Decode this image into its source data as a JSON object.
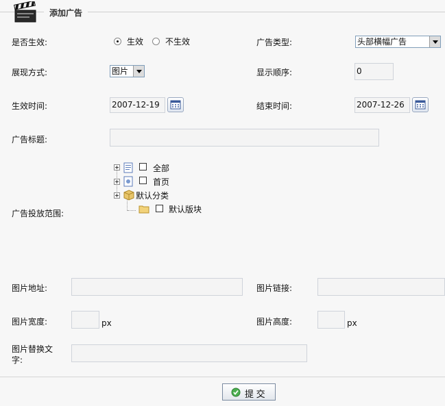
{
  "header": {
    "title": "添加广告",
    "icon": "clapperboard-icon"
  },
  "form": {
    "active_label": "是否生效:",
    "active_options": [
      "生效",
      "不生效"
    ],
    "active_selected": "生效",
    "ad_type_label": "广告类型:",
    "ad_type_value": "头部横幅广告",
    "display_mode_label": "展现方式:",
    "display_mode_value": "图片",
    "display_order_label": "显示顺序:",
    "display_order_value": "0",
    "start_time_label": "生效时间:",
    "start_time_value": "2007-12-19",
    "end_time_label": "结束时间:",
    "end_time_value": "2007-12-26",
    "ad_title_label": "广告标题:",
    "ad_title_value": "",
    "scope_label": "广告投放范围:",
    "scope_tree": {
      "all": "全部",
      "home": "首页",
      "default_category": "默认分类",
      "default_board": "默认版块"
    },
    "image_url_label": "图片地址:",
    "image_link_label": "图片链接:",
    "image_width_label": "图片宽度:",
    "image_height_label": "图片高度:",
    "px_unit": "px",
    "alt_text_label": "图片替换文字:"
  },
  "submit_label": "提 交"
}
